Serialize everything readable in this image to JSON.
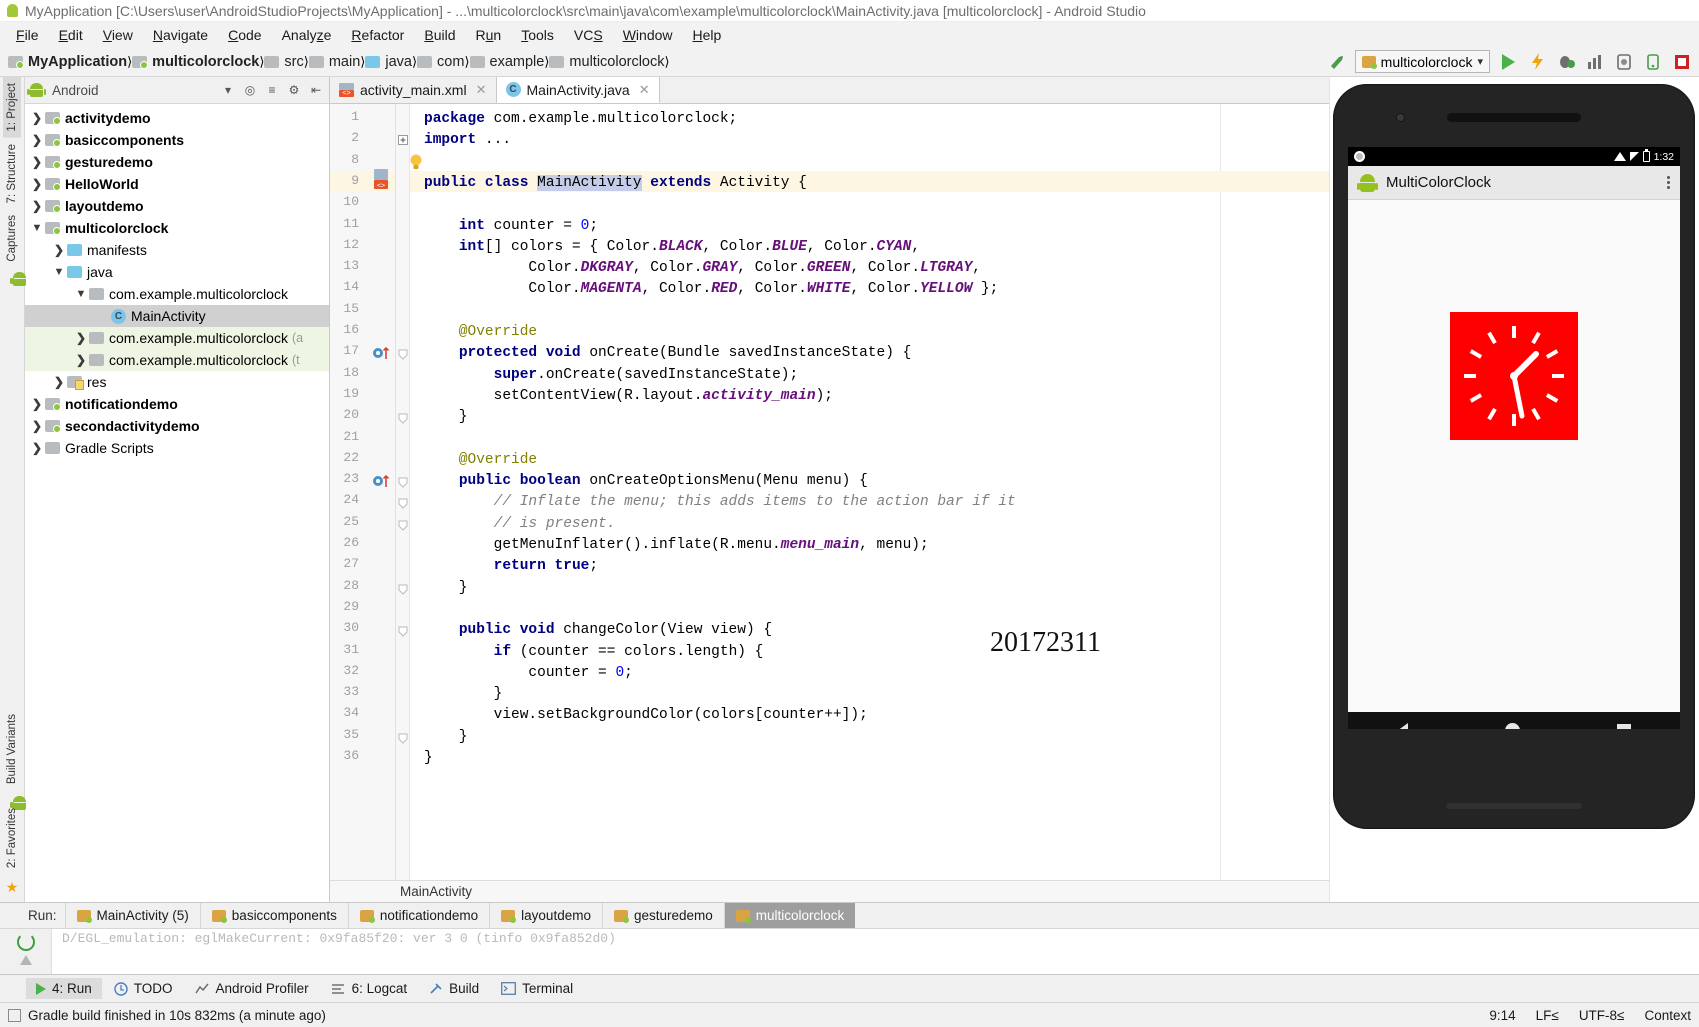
{
  "window": {
    "title": "MyApplication [C:\\Users\\user\\AndroidStudioProjects\\MyApplication] - ...\\multicolorclock\\src\\main\\java\\com\\example\\multicolorclock\\MainActivity.java [multicolorclock] - Android Studio",
    "icon": "android-icon"
  },
  "menubar": [
    {
      "label": "File"
    },
    {
      "label": "Edit"
    },
    {
      "label": "View"
    },
    {
      "label": "Navigate"
    },
    {
      "label": "Code"
    },
    {
      "label": "Analyze"
    },
    {
      "label": "Refactor"
    },
    {
      "label": "Build"
    },
    {
      "label": "Run"
    },
    {
      "label": "Tools"
    },
    {
      "label": "VCS"
    },
    {
      "label": "Window"
    },
    {
      "label": "Help"
    }
  ],
  "breadcrumb": [
    {
      "label": "MyApplication",
      "icon": "module-folder-icon",
      "bold": true
    },
    {
      "label": "multicolorclock",
      "icon": "module-folder-icon",
      "bold": true
    },
    {
      "label": "src",
      "icon": "folder-icon",
      "bold": false
    },
    {
      "label": "main",
      "icon": "folder-icon",
      "bold": false
    },
    {
      "label": "java",
      "icon": "folder-blue-icon",
      "bold": false
    },
    {
      "label": "com",
      "icon": "package-folder-icon",
      "bold": false
    },
    {
      "label": "example",
      "icon": "package-folder-icon",
      "bold": false
    },
    {
      "label": "multicolorclock",
      "icon": "package-folder-icon",
      "bold": false
    }
  ],
  "toolbar": {
    "run_config": "multicolorclock",
    "back_icon": "back-arrow-icon",
    "run_icon": "run-icon",
    "apply_changes_icon": "apply-changes-icon",
    "debug_icon": "debug-icon",
    "profile_icon": "profiler-icon",
    "attach_icon": "attach-debugger-icon",
    "avd_icon": "avd-manager-icon",
    "sdk_icon": "sdk-manager-icon"
  },
  "left_strip": [
    {
      "label": "1: Project"
    },
    {
      "label": "7: Structure"
    },
    {
      "label": "Captures"
    }
  ],
  "left_strip_bottom": [
    {
      "label": "Build Variants"
    },
    {
      "label": "2: Favorites"
    }
  ],
  "project_panel": {
    "title": "Android",
    "title_icon": "android-icon",
    "controls": [
      "target-icon",
      "collapse-icon",
      "gear-icon",
      "hide-icon"
    ],
    "tree": [
      {
        "label": "activitydemo",
        "indent": 0,
        "arrow": "right",
        "icon": "module-folder-icon",
        "bold": true,
        "state": "normal"
      },
      {
        "label": "basiccomponents",
        "indent": 0,
        "arrow": "right",
        "icon": "module-folder-icon",
        "bold": true,
        "state": "normal"
      },
      {
        "label": "gesturedemo",
        "indent": 0,
        "arrow": "right",
        "icon": "module-folder-icon",
        "bold": true,
        "state": "normal"
      },
      {
        "label": "HelloWorld",
        "indent": 0,
        "arrow": "right",
        "icon": "module-folder-icon",
        "bold": true,
        "state": "normal"
      },
      {
        "label": "layoutdemo",
        "indent": 0,
        "arrow": "right",
        "icon": "module-folder-icon",
        "bold": true,
        "state": "normal"
      },
      {
        "label": "multicolorclock",
        "indent": 0,
        "arrow": "down",
        "icon": "module-folder-icon",
        "bold": true,
        "state": "normal"
      },
      {
        "label": "manifests",
        "indent": 1,
        "arrow": "right",
        "icon": "folder-blue-icon",
        "bold": false,
        "state": "normal"
      },
      {
        "label": "java",
        "indent": 1,
        "arrow": "down",
        "icon": "folder-blue-icon",
        "bold": false,
        "state": "normal"
      },
      {
        "label": "com.example.multicolorclock",
        "indent": 2,
        "arrow": "down",
        "icon": "package-folder-icon",
        "bold": false,
        "state": "normal"
      },
      {
        "label": "MainActivity",
        "indent": 3,
        "arrow": "none",
        "icon": "java-class-icon",
        "bold": false,
        "state": "selected"
      },
      {
        "label": "com.example.multicolorclock",
        "suffix": "(a",
        "indent": 2,
        "arrow": "right",
        "icon": "package-folder-icon",
        "bold": false,
        "state": "highlight"
      },
      {
        "label": "com.example.multicolorclock",
        "suffix": "(t",
        "indent": 2,
        "arrow": "right",
        "icon": "package-folder-icon",
        "bold": false,
        "state": "highlight"
      },
      {
        "label": "res",
        "indent": 1,
        "arrow": "right",
        "icon": "res-folder-icon",
        "bold": false,
        "state": "normal"
      },
      {
        "label": "notificationdemo",
        "indent": 0,
        "arrow": "right",
        "icon": "module-folder-icon",
        "bold": true,
        "state": "normal"
      },
      {
        "label": "secondactivitydemo",
        "indent": 0,
        "arrow": "right",
        "icon": "module-folder-icon",
        "bold": true,
        "state": "normal"
      },
      {
        "label": "Gradle Scripts",
        "indent": 0,
        "arrow": "right",
        "icon": "gradle-icon",
        "bold": false,
        "state": "normal"
      }
    ]
  },
  "editor": {
    "tabs": [
      {
        "label": "activity_main.xml",
        "icon": "xml-layout-icon",
        "active": false
      },
      {
        "label": "MainActivity.java",
        "icon": "java-class-icon",
        "active": true
      }
    ],
    "watermark": "20172311",
    "breadcrumb_bottom": "MainActivity",
    "line_numbers": [
      1,
      2,
      8,
      9,
      10,
      11,
      12,
      13,
      14,
      15,
      16,
      17,
      18,
      19,
      20,
      21,
      22,
      23,
      24,
      25,
      26,
      27,
      28,
      29,
      30,
      31,
      32,
      33,
      34,
      35,
      36
    ],
    "highlighted_line": 9,
    "lines": [
      {
        "n": 1,
        "segments": [
          {
            "t": "package",
            "c": "kw"
          },
          {
            "t": " com.example.multicolorclock;",
            "c": "plain"
          }
        ]
      },
      {
        "n": 2,
        "segments": [
          {
            "t": "import",
            "c": "kw"
          },
          {
            "t": " ...",
            "c": "plain"
          }
        ]
      },
      {
        "n": 8,
        "segments": []
      },
      {
        "n": 9,
        "segments": [
          {
            "t": "public class",
            "c": "kw"
          },
          {
            "t": " ",
            "c": "plain"
          },
          {
            "t": "MainActivity",
            "c": "selbg"
          },
          {
            "t": " ",
            "c": "plain"
          },
          {
            "t": "extends",
            "c": "kw"
          },
          {
            "t": " Activity {",
            "c": "plain"
          }
        ]
      },
      {
        "n": 10,
        "segments": []
      },
      {
        "n": 11,
        "segments": [
          {
            "t": "    ",
            "c": "plain"
          },
          {
            "t": "int",
            "c": "kw"
          },
          {
            "t": " counter = ",
            "c": "plain"
          },
          {
            "t": "0",
            "c": "num"
          },
          {
            "t": ";",
            "c": "plain"
          }
        ]
      },
      {
        "n": 12,
        "segments": [
          {
            "t": "    ",
            "c": "plain"
          },
          {
            "t": "int",
            "c": "kw"
          },
          {
            "t": "[] colors = { Color.",
            "c": "plain"
          },
          {
            "t": "BLACK",
            "c": "cst"
          },
          {
            "t": ", Color.",
            "c": "plain"
          },
          {
            "t": "BLUE",
            "c": "cst"
          },
          {
            "t": ", Color.",
            "c": "plain"
          },
          {
            "t": "CYAN",
            "c": "cst"
          },
          {
            "t": ",",
            "c": "plain"
          }
        ]
      },
      {
        "n": 13,
        "segments": [
          {
            "t": "            Color.",
            "c": "plain"
          },
          {
            "t": "DKGRAY",
            "c": "cst"
          },
          {
            "t": ", Color.",
            "c": "plain"
          },
          {
            "t": "GRAY",
            "c": "cst"
          },
          {
            "t": ", Color.",
            "c": "plain"
          },
          {
            "t": "GREEN",
            "c": "cst"
          },
          {
            "t": ", Color.",
            "c": "plain"
          },
          {
            "t": "LTGRAY",
            "c": "cst"
          },
          {
            "t": ",",
            "c": "plain"
          }
        ]
      },
      {
        "n": 14,
        "segments": [
          {
            "t": "            Color.",
            "c": "plain"
          },
          {
            "t": "MAGENTA",
            "c": "cst"
          },
          {
            "t": ", Color.",
            "c": "plain"
          },
          {
            "t": "RED",
            "c": "cst"
          },
          {
            "t": ", Color.",
            "c": "plain"
          },
          {
            "t": "WHITE",
            "c": "cst"
          },
          {
            "t": ", Color.",
            "c": "plain"
          },
          {
            "t": "YELLOW",
            "c": "cst"
          },
          {
            "t": " };",
            "c": "plain"
          }
        ]
      },
      {
        "n": 15,
        "segments": []
      },
      {
        "n": 16,
        "segments": [
          {
            "t": "    @Override",
            "c": "ann"
          }
        ]
      },
      {
        "n": 17,
        "segments": [
          {
            "t": "    ",
            "c": "plain"
          },
          {
            "t": "protected void",
            "c": "kw"
          },
          {
            "t": " onCreate(Bundle savedInstanceState) {",
            "c": "plain"
          }
        ]
      },
      {
        "n": 18,
        "segments": [
          {
            "t": "        ",
            "c": "plain"
          },
          {
            "t": "super",
            "c": "kw"
          },
          {
            "t": ".onCreate(savedInstanceState);",
            "c": "plain"
          }
        ]
      },
      {
        "n": 19,
        "segments": [
          {
            "t": "        setContentView(R.layout.",
            "c": "plain"
          },
          {
            "t": "activity_main",
            "c": "cst"
          },
          {
            "t": ");",
            "c": "plain"
          }
        ]
      },
      {
        "n": 20,
        "segments": [
          {
            "t": "    }",
            "c": "plain"
          }
        ]
      },
      {
        "n": 21,
        "segments": []
      },
      {
        "n": 22,
        "segments": [
          {
            "t": "    @Override",
            "c": "ann"
          }
        ]
      },
      {
        "n": 23,
        "segments": [
          {
            "t": "    ",
            "c": "plain"
          },
          {
            "t": "public boolean",
            "c": "kw"
          },
          {
            "t": " onCreateOptionsMenu(Menu menu) {",
            "c": "plain"
          }
        ]
      },
      {
        "n": 24,
        "segments": [
          {
            "t": "        // Inflate the menu; this adds items to the action bar if it",
            "c": "cmt"
          }
        ]
      },
      {
        "n": 25,
        "segments": [
          {
            "t": "        // is present.",
            "c": "cmt"
          }
        ]
      },
      {
        "n": 26,
        "segments": [
          {
            "t": "        getMenuInflater().inflate(R.menu.",
            "c": "plain"
          },
          {
            "t": "menu_main",
            "c": "cst"
          },
          {
            "t": ", menu);",
            "c": "plain"
          }
        ]
      },
      {
        "n": 27,
        "segments": [
          {
            "t": "        ",
            "c": "plain"
          },
          {
            "t": "return true",
            "c": "kw"
          },
          {
            "t": ";",
            "c": "plain"
          }
        ]
      },
      {
        "n": 28,
        "segments": [
          {
            "t": "    }",
            "c": "plain"
          }
        ]
      },
      {
        "n": 29,
        "segments": []
      },
      {
        "n": 30,
        "segments": [
          {
            "t": "    ",
            "c": "plain"
          },
          {
            "t": "public void",
            "c": "kw"
          },
          {
            "t": " changeColor(View view) {",
            "c": "plain"
          }
        ]
      },
      {
        "n": 31,
        "segments": [
          {
            "t": "        ",
            "c": "plain"
          },
          {
            "t": "if",
            "c": "kw"
          },
          {
            "t": " (counter == colors.length) {",
            "c": "plain"
          }
        ]
      },
      {
        "n": 32,
        "segments": [
          {
            "t": "            counter = ",
            "c": "plain"
          },
          {
            "t": "0",
            "c": "num"
          },
          {
            "t": ";",
            "c": "plain"
          }
        ]
      },
      {
        "n": 33,
        "segments": [
          {
            "t": "        }",
            "c": "plain"
          }
        ]
      },
      {
        "n": 34,
        "segments": [
          {
            "t": "        view.setBackgroundColor(colors[counter++]);",
            "c": "plain"
          }
        ]
      },
      {
        "n": 35,
        "segments": [
          {
            "t": "    }",
            "c": "plain"
          }
        ]
      },
      {
        "n": 36,
        "segments": [
          {
            "t": "}",
            "c": "plain"
          }
        ]
      }
    ]
  },
  "emulator": {
    "status_time": "1:32",
    "app_title": "MultiColorClock",
    "app_icon": "android-icon",
    "overflow_icon": "overflow-menu-icon",
    "clock_background": "#FF0000",
    "clock_hands_color": "#FFFFFF",
    "nav_buttons": [
      "back-button",
      "home-button",
      "recents-button"
    ],
    "status_icons": [
      "wifi-icon",
      "signal-icon",
      "battery-icon"
    ]
  },
  "run_panel": {
    "label": "Run:",
    "tabs": [
      {
        "label": "MainActivity (5)",
        "active": false
      },
      {
        "label": "basiccomponents",
        "active": false
      },
      {
        "label": "notificationdemo",
        "active": false
      },
      {
        "label": "layoutdemo",
        "active": false
      },
      {
        "label": "gesturedemo",
        "active": false
      },
      {
        "label": "multicolorclock",
        "active": true
      }
    ],
    "console_line": "D/EGL_emulation: eglMakeCurrent: 0x9fa85f20: ver 3 0 (tinfo 0x9fa852d0)"
  },
  "bottom_tools": [
    {
      "label": "4: Run",
      "icon": "run-icon",
      "active": true,
      "underline_index": 0
    },
    {
      "label": "TODO",
      "icon": "todo-icon",
      "active": false
    },
    {
      "label": "Android Profiler",
      "icon": "profiler-icon",
      "active": false
    },
    {
      "label": "6: Logcat",
      "icon": "logcat-icon",
      "active": false,
      "underline_index": 0
    },
    {
      "label": "Build",
      "icon": "build-icon",
      "active": false
    },
    {
      "label": "Terminal",
      "icon": "terminal-icon",
      "active": false
    }
  ],
  "statusbar": {
    "message": "Gradle build finished in 10s 832ms (a minute ago)",
    "caret": "9:14",
    "line_sep": "LF≤",
    "encoding": "UTF-8≤",
    "context": "Context"
  }
}
